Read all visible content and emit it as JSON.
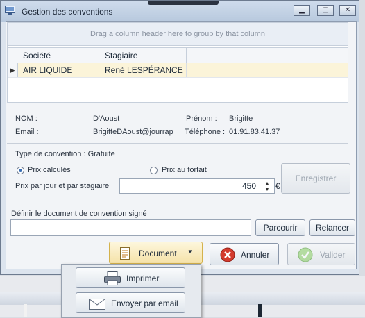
{
  "window": {
    "title": "Gestion des conventions"
  },
  "grid": {
    "group_hint": "Drag a column header here to group by that column",
    "columns": [
      "Société",
      "Stagiaire"
    ],
    "rows": [
      {
        "societe": "AIR LIQUIDE",
        "stagiaire": "René LESPÉRANCE"
      }
    ]
  },
  "details": {
    "nom_label": "NOM :",
    "nom_value": "D'Aoust",
    "prenom_label": "Prénom :",
    "prenom_value": "Brigitte",
    "email_label": "Email :",
    "email_value": "BrigitteDAoust@jourrap",
    "tel_label": "Téléphone :",
    "tel_value": "01.91.83.41.37"
  },
  "convention": {
    "type_label": "Type de convention : Gratuite",
    "option_calc": "Prix calculés",
    "option_forfait": "Prix au forfait",
    "selected": "Prix calculés",
    "price_label": "Prix par jour et par stagiaire",
    "price_value": "450",
    "currency": "€",
    "save_label": "Enregistrer"
  },
  "document": {
    "label": "Définir le document de convention signé",
    "path_value": "",
    "browse_label": "Parcourir",
    "remind_label": "Relancer"
  },
  "actions": {
    "document_label": "Document",
    "cancel_label": "Annuler",
    "validate_label": "Valider"
  },
  "menu": {
    "print_label": "Imprimer",
    "email_label": "Envoyer par email"
  },
  "background": {
    "fragment": "r"
  },
  "colors": {
    "selected_row": "#fbf4d9",
    "accent": "#3b6fb4",
    "document_button": "#f5e2a8"
  }
}
